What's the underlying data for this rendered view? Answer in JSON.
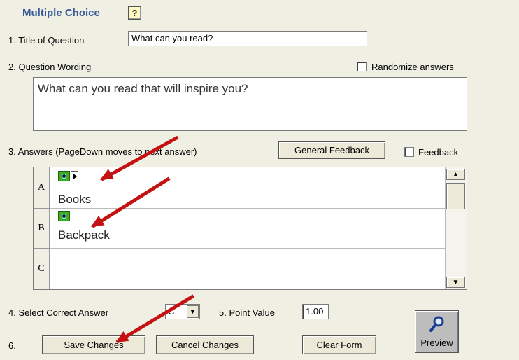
{
  "header": {
    "title": "Multiple Choice",
    "help_icon_glyph": "?"
  },
  "q1": {
    "label": "1.  Title of Question",
    "value": "What can you read?"
  },
  "q2": {
    "label": "2.  Question Wording",
    "randomize_label": "Randomize answers",
    "randomize_checked": false,
    "value": "What can you read that will inspire you?"
  },
  "q3": {
    "label": "3.  Answers  (PageDown moves to next answer)",
    "general_feedback_label": "General Feedback",
    "feedback_label": "Feedback"
  },
  "answers": [
    {
      "letter": "A",
      "text": "Books",
      "has_media": true,
      "has_play": true
    },
    {
      "letter": "B",
      "text": "Backpack",
      "has_media": true,
      "has_play": false
    },
    {
      "letter": "C",
      "text": "",
      "has_media": false,
      "has_play": false
    }
  ],
  "q4": {
    "label": "4.  Select Correct Answer",
    "selected": "C"
  },
  "q5": {
    "label": "5.  Point Value",
    "value": "1.00"
  },
  "q6": {
    "label": "6.",
    "save_label": "Save Changes",
    "cancel_label": "Cancel Changes",
    "clear_label": "Clear Form"
  },
  "preview": {
    "label": "Preview",
    "icon": "magnifier-icon"
  },
  "scrollbar": {
    "up_glyph": "▲",
    "down_glyph": "▼"
  },
  "annotation": {
    "arrow_color": "#c41212",
    "arrow_count": 3
  },
  "colors": {
    "title": "#3a5a9a",
    "background": "#efefe3"
  }
}
